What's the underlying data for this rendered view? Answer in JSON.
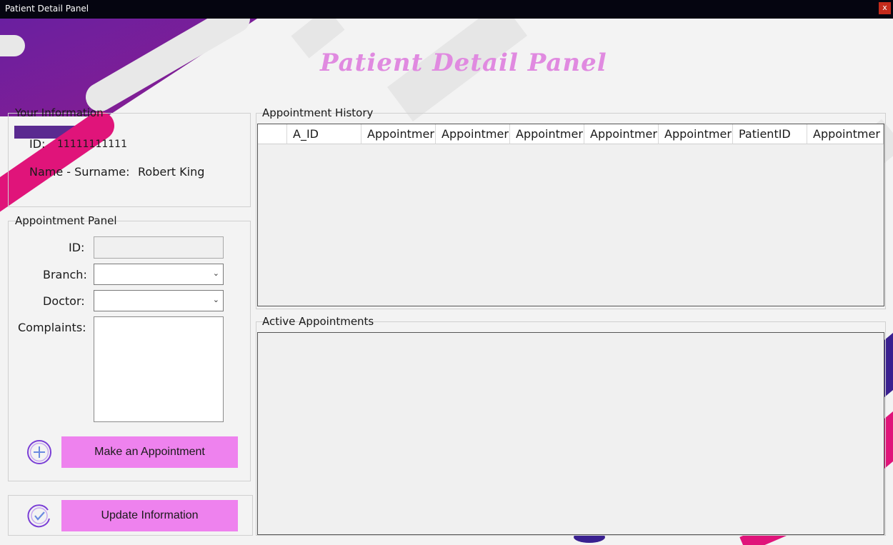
{
  "window": {
    "title": "Patient Detail Panel",
    "close_label": "x"
  },
  "header": {
    "title": "Patient Detail Panel"
  },
  "your_info": {
    "legend": "Your Information",
    "id_label": "ID:",
    "id_value": "11111111111",
    "name_label": "Name - Surname:",
    "name_value": "Robert King"
  },
  "appointment_panel": {
    "legend": "Appointment Panel",
    "id_label": "ID:",
    "id_value": "",
    "branch_label": "Branch:",
    "branch_value": "",
    "doctor_label": "Doctor:",
    "doctor_value": "",
    "complaints_label": "Complaints:",
    "complaints_value": "",
    "make_button": "Make an Appointment",
    "make_icon": "plus-circle-icon"
  },
  "update": {
    "button": "Update Information",
    "icon": "check-circle-icon"
  },
  "history": {
    "legend": "Appointment History",
    "columns": [
      "A_ID",
      "Appointmer",
      "Appointmer",
      "Appointmer",
      "Appointmer",
      "Appointmer",
      "PatientID",
      "Appointmer"
    ],
    "rows": []
  },
  "active": {
    "legend": "Active Appointments",
    "rows": []
  },
  "colors": {
    "accent": "#ee82ee",
    "title": "#e08ae0",
    "magenta": "#e0147a",
    "purple": "#4a1e8c"
  }
}
